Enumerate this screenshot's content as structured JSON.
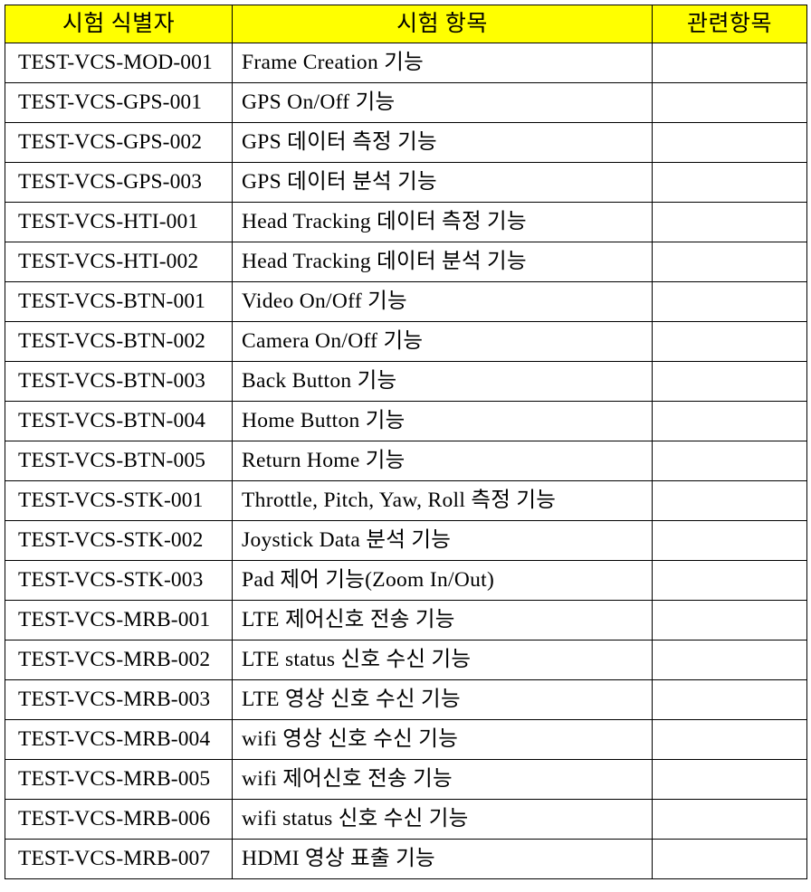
{
  "table": {
    "headers": [
      {
        "label": "시험 식별자",
        "name": "test-identifier"
      },
      {
        "label": "시험 항목",
        "name": "test-item"
      },
      {
        "label": "관련항목",
        "name": "related-item"
      }
    ],
    "header_bg": "#FFFF00",
    "border_color": "#000000",
    "rows": [
      {
        "id": "TEST-VCS-MOD-001",
        "item": "Frame Creation 기능",
        "related": ""
      },
      {
        "id": "TEST-VCS-GPS-001",
        "item": "GPS On/Off 기능",
        "related": ""
      },
      {
        "id": "TEST-VCS-GPS-002",
        "item": "GPS 데이터 측정 기능",
        "related": ""
      },
      {
        "id": "TEST-VCS-GPS-003",
        "item": "GPS 데이터 분석 기능",
        "related": ""
      },
      {
        "id": "TEST-VCS-HTI-001",
        "item": "Head Tracking 데이터 측정 기능",
        "related": ""
      },
      {
        "id": "TEST-VCS-HTI-002",
        "item": "Head Tracking 데이터 분석 기능",
        "related": ""
      },
      {
        "id": "TEST-VCS-BTN-001",
        "item": "Video On/Off 기능",
        "related": ""
      },
      {
        "id": "TEST-VCS-BTN-002",
        "item": "Camera On/Off 기능",
        "related": ""
      },
      {
        "id": "TEST-VCS-BTN-003",
        "item": "Back Button 기능",
        "related": ""
      },
      {
        "id": "TEST-VCS-BTN-004",
        "item": "Home Button 기능",
        "related": ""
      },
      {
        "id": "TEST-VCS-BTN-005",
        "item": "Return Home 기능",
        "related": ""
      },
      {
        "id": "TEST-VCS-STK-001",
        "item": "Throttle, Pitch, Yaw, Roll 측정 기능",
        "related": ""
      },
      {
        "id": "TEST-VCS-STK-002",
        "item": "Joystick Data 분석 기능",
        "related": ""
      },
      {
        "id": "TEST-VCS-STK-003",
        "item": "Pad 제어 기능(Zoom In/Out)",
        "related": ""
      },
      {
        "id": "TEST-VCS-MRB-001",
        "item": "LTE 제어신호 전송 기능",
        "related": ""
      },
      {
        "id": "TEST-VCS-MRB-002",
        "item": "LTE status 신호 수신 기능",
        "related": ""
      },
      {
        "id": "TEST-VCS-MRB-003",
        "item": "LTE 영상 신호 수신 기능",
        "related": ""
      },
      {
        "id": "TEST-VCS-MRB-004",
        "item": "wifi 영상 신호 수신 기능",
        "related": ""
      },
      {
        "id": "TEST-VCS-MRB-005",
        "item": "wifi 제어신호 전송 기능",
        "related": ""
      },
      {
        "id": "TEST-VCS-MRB-006",
        "item": "wifi status 신호 수신 기능",
        "related": ""
      },
      {
        "id": "TEST-VCS-MRB-007",
        "item": "HDMI 영상 표출 기능",
        "related": ""
      }
    ]
  }
}
